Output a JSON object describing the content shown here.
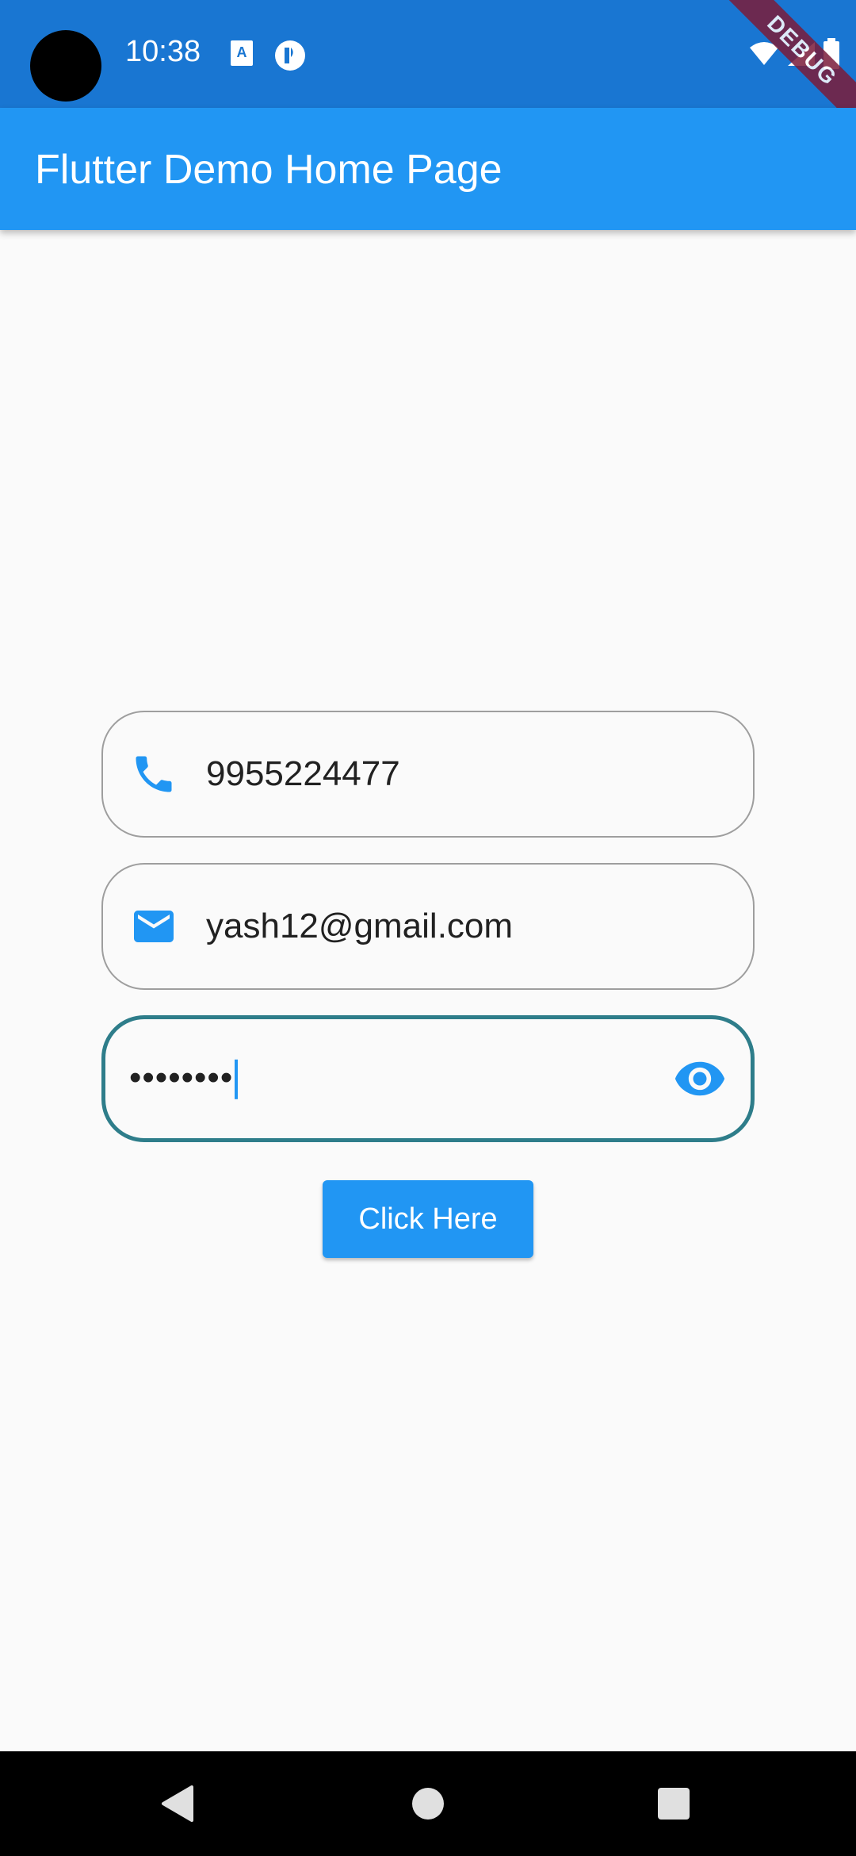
{
  "status_bar": {
    "time": "10:38"
  },
  "debug_banner": "DEBUG",
  "app_bar": {
    "title": "Flutter Demo Home Page"
  },
  "form": {
    "phone": {
      "value": "9955224477",
      "icon": "phone-icon"
    },
    "email": {
      "value": "yash12@gmail.com",
      "icon": "mail-icon"
    },
    "password": {
      "value": "••••••••",
      "icon": "eye-icon"
    },
    "submit_label": "Click Here"
  },
  "colors": {
    "primary": "#2196f3",
    "status_bar": "#1976d2",
    "focus_border": "#2e7d8a"
  }
}
